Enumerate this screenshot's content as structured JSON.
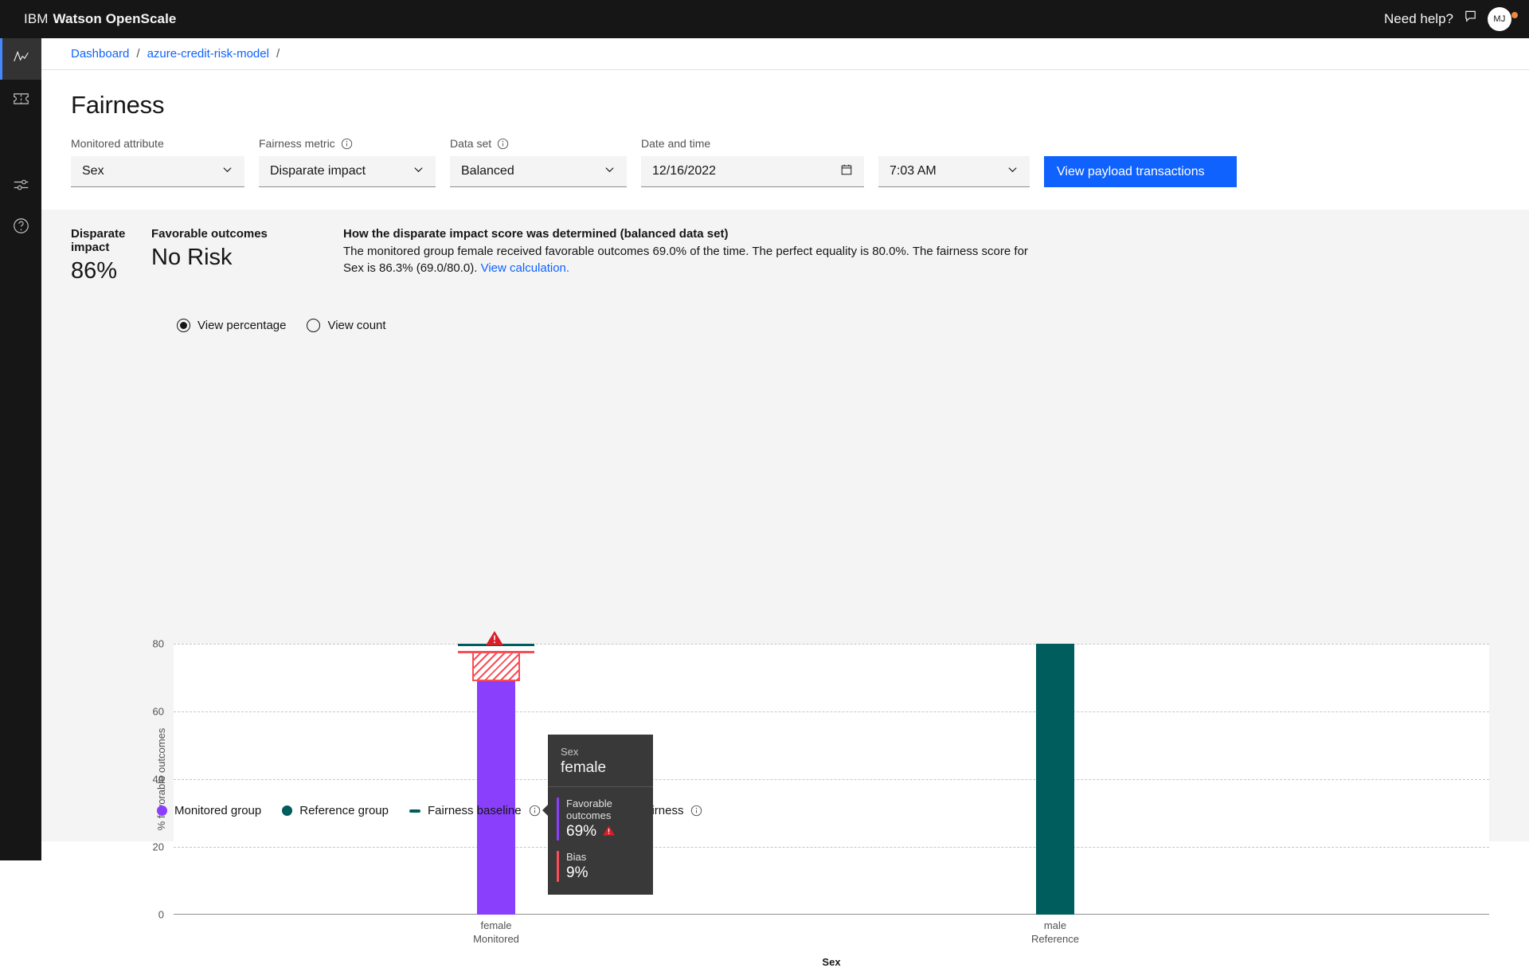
{
  "topbar": {
    "brand_prefix": "IBM",
    "brand_name": "Watson OpenScale",
    "need_help": "Need help?",
    "chat_icon": "chat-icon",
    "avatar_initials": "MJ"
  },
  "rail": {
    "items": [
      {
        "icon": "activity-monitor-icon",
        "name": "sidebar-item-monitors",
        "active": true
      },
      {
        "icon": "model-ticket-icon",
        "name": "sidebar-item-models",
        "active": false
      },
      {
        "icon": "sliders-settings-icon",
        "name": "sidebar-item-configure",
        "active": false
      },
      {
        "icon": "help-circle-icon",
        "name": "sidebar-item-help",
        "active": false
      }
    ]
  },
  "breadcrumb": {
    "items": [
      "Dashboard",
      "azure-credit-risk-model"
    ],
    "separator": "/",
    "trailing_separator": "/"
  },
  "page": {
    "title": "Fairness"
  },
  "filters": {
    "monitored_attribute": {
      "label": "Monitored attribute",
      "value": "Sex",
      "has_info": false
    },
    "fairness_metric": {
      "label": "Fairness metric",
      "value": "Disparate impact",
      "has_info": true
    },
    "data_set": {
      "label": "Data set",
      "value": "Balanced",
      "has_info": true
    },
    "date_and_time": {
      "label": "Date and time",
      "date": "12/16/2022",
      "time": "7:03 AM"
    },
    "primary_button": "View payload transactions"
  },
  "summary": {
    "disparate_impact": {
      "label": "Disparate impact",
      "value": "86%"
    },
    "favorable_outcomes": {
      "label": "Favorable outcomes",
      "value": "No Risk"
    },
    "explanation": {
      "title": "How the disparate impact score was determined (balanced data set)",
      "body": "The monitored group female received favorable outcomes 69.0% of the time. The perfect equality is 80.0%. The fairness score for Sex is 86.3% (69.0/80.0).",
      "link": "View calculation."
    }
  },
  "view_toggle": {
    "options": [
      {
        "label": "View percentage",
        "checked": true
      },
      {
        "label": "View count",
        "checked": false
      }
    ]
  },
  "tooltip": {
    "group_key": "Sex",
    "group_value": "female",
    "rows": [
      {
        "key": "Favorable outcomes",
        "value": "69%",
        "color": "#8a3ffc",
        "warning": true
      },
      {
        "key": "Bias",
        "value": "9%",
        "color": "#fa4d56",
        "warning": false
      }
    ],
    "warning_icon": "warning-triangle-icon"
  },
  "legend": {
    "items": [
      {
        "label": "Monitored group",
        "marker": "dot",
        "color": "#8a3ffc",
        "has_info": false
      },
      {
        "label": "Reference group",
        "marker": "dot",
        "color": "#005d5d",
        "has_info": false
      },
      {
        "label": "Fairness baseline",
        "marker": "line",
        "color": "#005d5d",
        "has_info": true
      },
      {
        "label": "Acceptable fairness",
        "marker": "line",
        "color": "#fa4d56",
        "has_info": true
      }
    ]
  },
  "chart_data": {
    "type": "bar",
    "title": "",
    "xlabel": "Sex",
    "ylabel": "% favorable outcomes",
    "ylim": [
      0,
      80
    ],
    "yticks": [
      0,
      20,
      40,
      60,
      80
    ],
    "grid": true,
    "legend_position": "bottom-left",
    "categories": [
      "female",
      "male"
    ],
    "category_sublabels": [
      "Monitored",
      "Reference"
    ],
    "series": [
      {
        "name": "Monitored group",
        "color": "#8a3ffc",
        "values": [
          69,
          null
        ]
      },
      {
        "name": "Reference group",
        "color": "#005d5d",
        "values": [
          null,
          80
        ]
      }
    ],
    "annotations": {
      "fairness_baseline": {
        "value": 80,
        "color": "#005d5d",
        "category": "female"
      },
      "acceptable_fairness": {
        "value": 78,
        "color": "#fa4d56",
        "category": "female"
      },
      "bias_band": {
        "from": 69,
        "to": 78,
        "color": "#fa4d56",
        "category": "female",
        "hatched": true
      },
      "alert_marker": {
        "category": "female",
        "icon": "warning-triangle-icon",
        "color": "#da1e28"
      }
    }
  }
}
